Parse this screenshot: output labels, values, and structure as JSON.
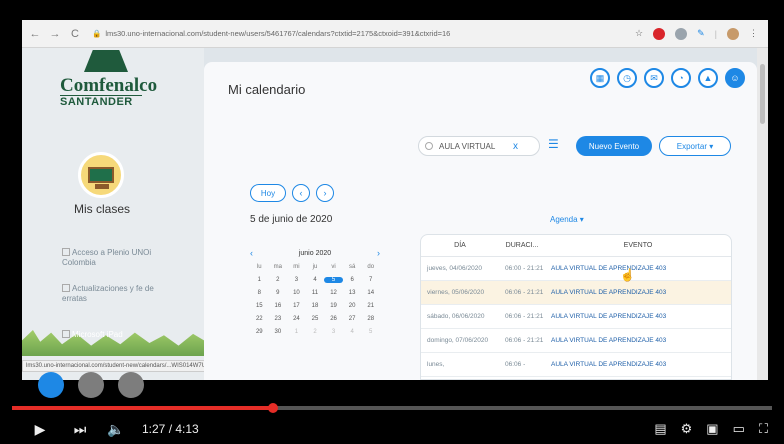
{
  "browser": {
    "url": "lms30.uno-internacional.com/student-new/users/5461767/calendars?ctxtid=2175&ctxoid=391&ctxrid=16",
    "back": "←",
    "forward": "→",
    "reload": "C"
  },
  "sidebar": {
    "logo_name": "Comfenalco",
    "logo_sub": "SANTANDER",
    "clases_label": "Mis clases",
    "links": [
      {
        "label": "Acceso a Plenio UNOi Colombia"
      },
      {
        "label": "Actualizaciones y fe de erratas"
      },
      {
        "label": "Microsoft iPad"
      }
    ],
    "status_url": "lms30.uno-internacional.com/student-new/calendars/...WIS014W7U74..."
  },
  "main": {
    "page_title": "Mi calendario",
    "search": {
      "value": "AULA VIRTUAL",
      "clear": "x"
    },
    "btn_nuevo": "Nuevo Evento",
    "btn_exportar": "Exportar ▾",
    "btn_hoy": "Hoy",
    "btn_prev": "‹",
    "btn_next": "›",
    "date_label": "5 de junio de 2020",
    "agenda_select": "Agenda ▾",
    "mini_calendar": {
      "month": "junio 2020",
      "prev": "‹",
      "next": "›",
      "day_headers": [
        "lu",
        "ma",
        "mi",
        "ju",
        "vi",
        "sá",
        "do"
      ],
      "days": [
        "1",
        "2",
        "3",
        "4",
        "5",
        "6",
        "7",
        "8",
        "9",
        "10",
        "11",
        "12",
        "13",
        "14",
        "15",
        "16",
        "17",
        "18",
        "19",
        "20",
        "21",
        "22",
        "23",
        "24",
        "25",
        "26",
        "27",
        "28",
        "29",
        "30",
        "1",
        "2",
        "3",
        "4",
        "5"
      ],
      "selected": "5"
    },
    "table": {
      "headers": {
        "dia": "DÍA",
        "duracion": "DURACI...",
        "evento": "EVENTO"
      },
      "rows": [
        {
          "dia": "jueves, 04/06/2020",
          "duracion": "06:00 - 21:21",
          "evento": "AULA VIRTUAL DE APRENDIZAJE 403",
          "highlight": false
        },
        {
          "dia": "viernes, 05/06/2020",
          "duracion": "06:06 - 21:21",
          "evento": "AULA VIRTUAL DE APRENDIZAJE 403",
          "highlight": true
        },
        {
          "dia": "sábado, 06/06/2020",
          "duracion": "06:06 - 21:21",
          "evento": "AULA VIRTUAL DE APRENDIZAJE 403",
          "highlight": false
        },
        {
          "dia": "domingo, 07/06/2020",
          "duracion": "06:06 - 21:21",
          "evento": "AULA VIRTUAL DE APRENDIZAJE 403",
          "highlight": false
        },
        {
          "dia": "lunes,",
          "duracion": "06:06 -",
          "evento": "AULA VIRTUAL DE APRENDIZAJE 403",
          "highlight": false
        }
      ]
    },
    "accent_color": "#1e88e5"
  },
  "video": {
    "time": "1:27 / 4:13",
    "progress_fraction": 0.344,
    "dots": [
      {
        "active": true
      },
      {
        "active": false
      },
      {
        "active": false
      }
    ]
  }
}
